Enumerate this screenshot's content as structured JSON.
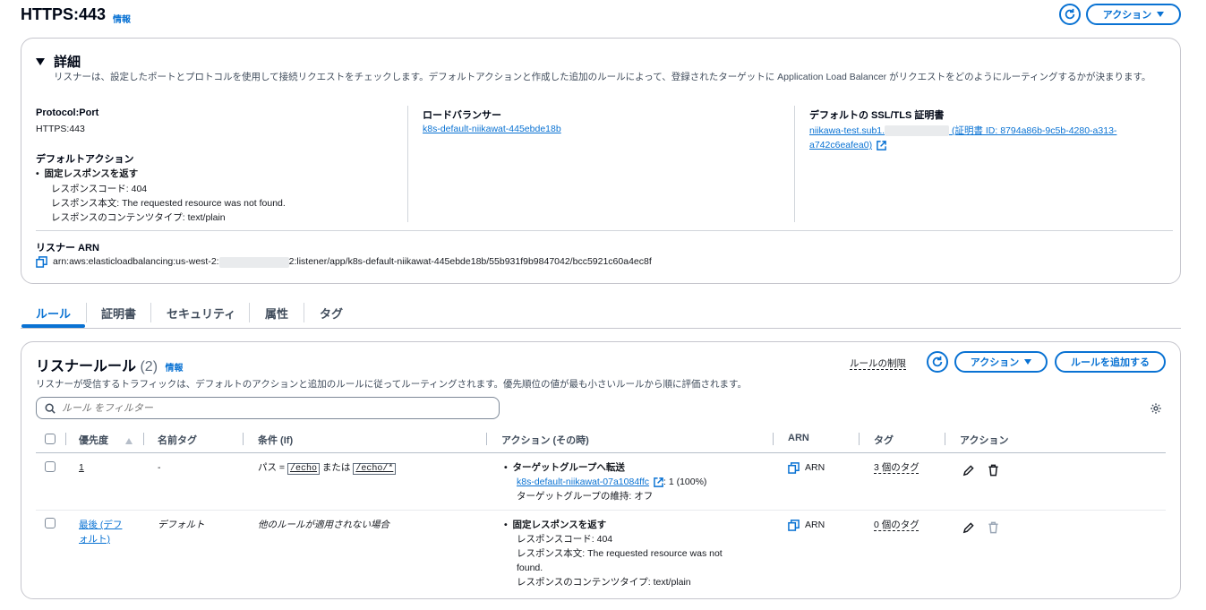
{
  "header": {
    "title": "HTTPS:443",
    "info": "情報",
    "actions_label": "アクション"
  },
  "details": {
    "title": "詳細",
    "description": "リスナーは、設定したポートとプロトコルを使用して接続リクエストをチェックします。デフォルトアクションと作成した追加のルールによって、登録されたターゲットに Application Load Balancer がリクエストをどのようにルーティングするかが決まります。",
    "protocol_port_label": "Protocol:Port",
    "protocol_port_value": "HTTPS:443",
    "default_action_label": "デフォルトアクション",
    "default_action_type": "固定レスポンスを返す",
    "response_code": "レスポンスコード: 404",
    "response_body": "レスポンス本文: The requested resource was not found.",
    "response_content_type": "レスポンスのコンテンツタイプ: text/plain",
    "load_balancer_label": "ロードバランサー",
    "load_balancer_value": "k8s-default-niikawat-445ebde18b",
    "cert_label": "デフォルトの SSL/TLS 証明書",
    "cert_value_prefix": "niikawa-test.sub1.",
    "cert_value_suffix": " (証明書 ID: 8794a86b-9c5b-4280-a313-",
    "cert_value_line2": "a742c6eafea0)",
    "arn_label": "リスナー ARN",
    "arn_prefix": "arn:aws:elasticloadbalancing:us-west-2:",
    "arn_suffix": "2:listener/app/k8s-default-niikawat-445ebde18b/55b931f9b9847042/bcc5921c60a4ec8f"
  },
  "tabs": [
    {
      "label": "ルール"
    },
    {
      "label": "証明書"
    },
    {
      "label": "セキュリティ"
    },
    {
      "label": "属性"
    },
    {
      "label": "タグ"
    }
  ],
  "rules": {
    "title": "リスナールール",
    "count": "(2)",
    "info": "情報",
    "limit_link": "ルールの制限",
    "actions_label": "アクション",
    "add_rule_label": "ルールを追加する",
    "description": "リスナーが受信するトラフィックは、デフォルトのアクションと追加のルールに従ってルーティングされます。優先順位の値が最も小さいルールから順に評価されます。",
    "filter_placeholder": "ルール をフィルター",
    "columns": {
      "priority": "優先度",
      "name_tag": "名前タグ",
      "condition": "条件 (If)",
      "action": "アクション (その時)",
      "arn": "ARN",
      "tags": "タグ",
      "actions": "アクション"
    },
    "rows": [
      {
        "priority": "1",
        "name_tag": "-",
        "cond_prefix": "パス = ",
        "cond_path1": "/echo",
        "cond_or": " または ",
        "cond_path2": "/echo/*",
        "action_type": "ターゲットグループへ転送",
        "target_group": "k8s-default-niikawat-07a1084ffc",
        "weight": ": 1 (100%)",
        "stickiness": "ターゲットグループの維持: オフ",
        "arn": "ARN",
        "tags": "3 個のタグ"
      },
      {
        "priority_line1": "最後 (デフ",
        "priority_line2": "ォルト)",
        "name_tag": "デフォルト",
        "condition": "他のルールが適用されない場合",
        "action_type": "固定レスポンスを返す",
        "response_code": "レスポンスコード: 404",
        "response_body_line1": "レスポンス本文: The requested resource was not",
        "response_body_line2": "found.",
        "content_type": "レスポンスのコンテンツタイプ: text/plain",
        "arn": "ARN",
        "tags": "0 個のタグ"
      }
    ]
  },
  "colors": {
    "link": "#0972d3",
    "border": "#c6c6cd",
    "text": "#16191f"
  }
}
